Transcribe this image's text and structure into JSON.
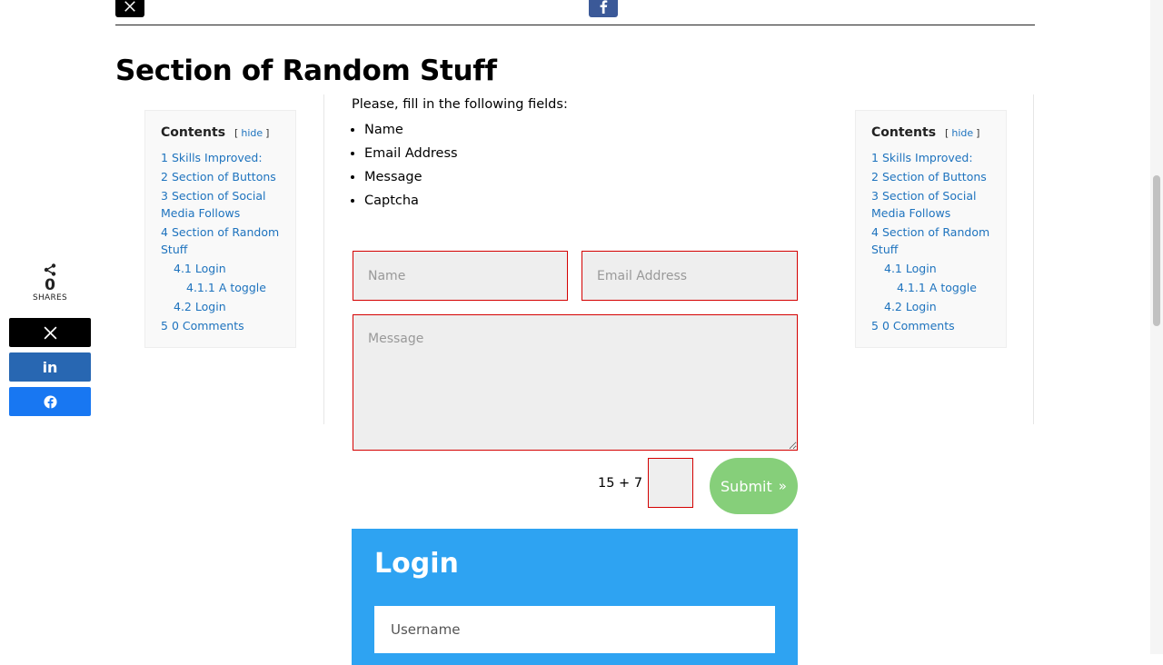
{
  "section": {
    "title": "Section of Random Stuff"
  },
  "toc": {
    "heading": "Contents",
    "toggle_open": "[",
    "toggle_label": "hide",
    "toggle_close": "]",
    "items": [
      {
        "num": "1",
        "label": "Skills Improved:",
        "level": 1
      },
      {
        "num": "2",
        "label": "Section of Buttons",
        "level": 1
      },
      {
        "num": "3",
        "label": "Section of Social Media Follows",
        "level": 1
      },
      {
        "num": "4",
        "label": "Section of Random Stuff",
        "level": 1
      },
      {
        "num": "4.1",
        "label": "Login",
        "level": 2
      },
      {
        "num": "4.1.1",
        "label": "A toggle",
        "level": 3
      },
      {
        "num": "4.2",
        "label": "Login",
        "level": 2
      },
      {
        "num": "5",
        "label": "0 Comments",
        "level": 1
      }
    ]
  },
  "share": {
    "count": "0",
    "label": "SHARES"
  },
  "form": {
    "intro": "Please, fill in the following fields:",
    "fields": [
      "Name",
      "Email Address",
      "Message",
      "Captcha"
    ],
    "name_placeholder": "Name",
    "email_placeholder": "Email Address",
    "message_placeholder": "Message",
    "captcha_question": "15 + 7 =",
    "submit_label": "Submit",
    "submit_arrow": "»"
  },
  "login": {
    "title": "Login",
    "username_placeholder": "Username"
  },
  "colors": {
    "accent": "#2ea3f2",
    "link": "#1e73be",
    "submit": "#86cf7a",
    "error_border": "#d40000",
    "twitter": "#000000",
    "linkedin": "#0077b5",
    "facebook": "#1877f2"
  }
}
